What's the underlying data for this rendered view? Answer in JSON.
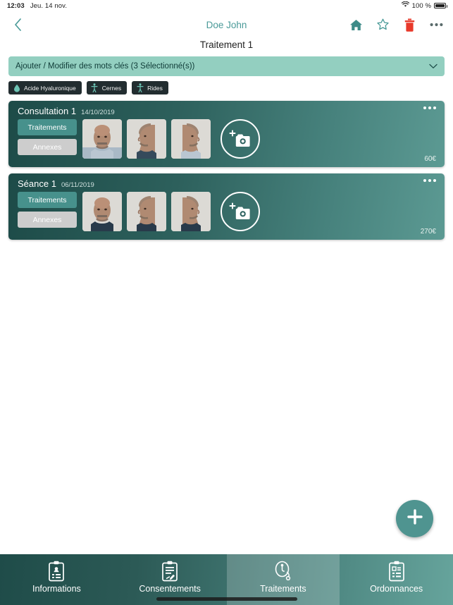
{
  "status_bar": {
    "time": "12:03",
    "date": "Jeu. 14 nov.",
    "battery_percent": "100 %",
    "wifi_icon": "wifi-icon",
    "battery_icon": "battery-full-icon"
  },
  "nav": {
    "back_icon": "chevron-left-icon",
    "patient_name": "Doe John",
    "actions": [
      {
        "name": "home-icon",
        "label": "Accueil"
      },
      {
        "name": "star-icon",
        "label": "Favori"
      },
      {
        "name": "trash-icon",
        "label": "Supprimer"
      },
      {
        "name": "more-icon",
        "label": "Plus"
      }
    ],
    "accent_color": "#4a9a98",
    "delete_color": "#e8392a"
  },
  "page": {
    "title": "Traitement 1"
  },
  "keywords": {
    "select_label": "Ajouter / Modifier des mots clés (3 Sélectionné(s))",
    "chevron_icon": "chevron-down-icon",
    "background_color": "#93cfc0",
    "chips": [
      {
        "label": "Acide Hyaluronique",
        "icon": "droplet-icon"
      },
      {
        "label": "Cernes",
        "icon": "body-icon"
      },
      {
        "label": "Rides",
        "icon": "body-icon"
      }
    ]
  },
  "sessions": [
    {
      "title": "Consultation 1",
      "date": "14/10/2019",
      "price": "60€",
      "menu_icon": "more-icon",
      "segments": [
        {
          "label": "Traitements",
          "selected": true
        },
        {
          "label": "Annexes",
          "selected": false
        }
      ],
      "photos": [
        {
          "name": "patient-photo-front"
        },
        {
          "name": "patient-photo-left-profile"
        },
        {
          "name": "patient-photo-right-profile"
        }
      ],
      "add_photo_icon": "add-photo-icon"
    },
    {
      "title": "Séance 1",
      "date": "06/11/2019",
      "price": "270€",
      "menu_icon": "more-icon",
      "segments": [
        {
          "label": "Traitements",
          "selected": true
        },
        {
          "label": "Annexes",
          "selected": false
        }
      ],
      "photos": [
        {
          "name": "patient-photo-front"
        },
        {
          "name": "patient-photo-left-profile"
        },
        {
          "name": "patient-photo-right-profile"
        }
      ],
      "add_photo_icon": "add-photo-icon"
    }
  ],
  "fab": {
    "icon": "plus-icon",
    "label": "Ajouter",
    "color": "#4f9490"
  },
  "tabbar": {
    "items": [
      {
        "label": "Informations",
        "icon": "clipboard-person-icon",
        "active": false
      },
      {
        "label": "Consentements",
        "icon": "clipboard-pen-icon",
        "active": false
      },
      {
        "label": "Traitements",
        "icon": "stethoscope-icon",
        "active": true
      },
      {
        "label": "Ordonnances",
        "icon": "clipboard-list-icon",
        "active": false
      }
    ]
  }
}
